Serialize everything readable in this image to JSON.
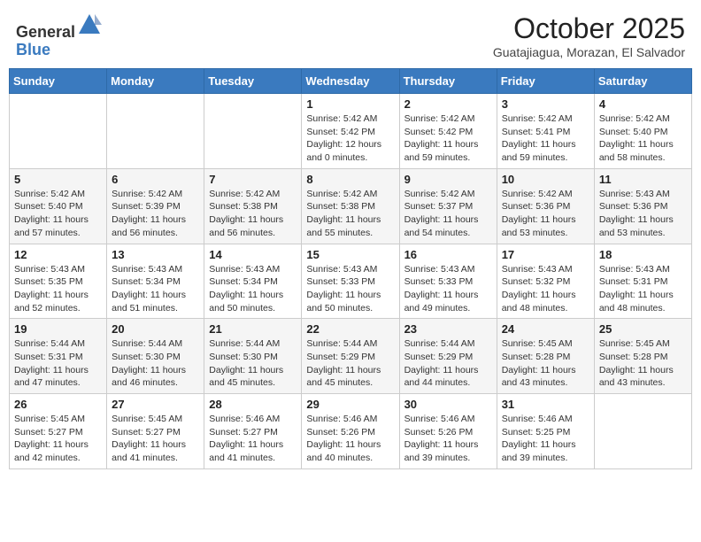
{
  "logo": {
    "general": "General",
    "blue": "Blue"
  },
  "header": {
    "month": "October 2025",
    "location": "Guatajiagua, Morazan, El Salvador"
  },
  "days_of_week": [
    "Sunday",
    "Monday",
    "Tuesday",
    "Wednesday",
    "Thursday",
    "Friday",
    "Saturday"
  ],
  "weeks": [
    [
      {
        "day": "",
        "info": ""
      },
      {
        "day": "",
        "info": ""
      },
      {
        "day": "",
        "info": ""
      },
      {
        "day": "1",
        "info": "Sunrise: 5:42 AM\nSunset: 5:42 PM\nDaylight: 12 hours\nand 0 minutes."
      },
      {
        "day": "2",
        "info": "Sunrise: 5:42 AM\nSunset: 5:42 PM\nDaylight: 11 hours\nand 59 minutes."
      },
      {
        "day": "3",
        "info": "Sunrise: 5:42 AM\nSunset: 5:41 PM\nDaylight: 11 hours\nand 59 minutes."
      },
      {
        "day": "4",
        "info": "Sunrise: 5:42 AM\nSunset: 5:40 PM\nDaylight: 11 hours\nand 58 minutes."
      }
    ],
    [
      {
        "day": "5",
        "info": "Sunrise: 5:42 AM\nSunset: 5:40 PM\nDaylight: 11 hours\nand 57 minutes."
      },
      {
        "day": "6",
        "info": "Sunrise: 5:42 AM\nSunset: 5:39 PM\nDaylight: 11 hours\nand 56 minutes."
      },
      {
        "day": "7",
        "info": "Sunrise: 5:42 AM\nSunset: 5:38 PM\nDaylight: 11 hours\nand 56 minutes."
      },
      {
        "day": "8",
        "info": "Sunrise: 5:42 AM\nSunset: 5:38 PM\nDaylight: 11 hours\nand 55 minutes."
      },
      {
        "day": "9",
        "info": "Sunrise: 5:42 AM\nSunset: 5:37 PM\nDaylight: 11 hours\nand 54 minutes."
      },
      {
        "day": "10",
        "info": "Sunrise: 5:42 AM\nSunset: 5:36 PM\nDaylight: 11 hours\nand 53 minutes."
      },
      {
        "day": "11",
        "info": "Sunrise: 5:43 AM\nSunset: 5:36 PM\nDaylight: 11 hours\nand 53 minutes."
      }
    ],
    [
      {
        "day": "12",
        "info": "Sunrise: 5:43 AM\nSunset: 5:35 PM\nDaylight: 11 hours\nand 52 minutes."
      },
      {
        "day": "13",
        "info": "Sunrise: 5:43 AM\nSunset: 5:34 PM\nDaylight: 11 hours\nand 51 minutes."
      },
      {
        "day": "14",
        "info": "Sunrise: 5:43 AM\nSunset: 5:34 PM\nDaylight: 11 hours\nand 50 minutes."
      },
      {
        "day": "15",
        "info": "Sunrise: 5:43 AM\nSunset: 5:33 PM\nDaylight: 11 hours\nand 50 minutes."
      },
      {
        "day": "16",
        "info": "Sunrise: 5:43 AM\nSunset: 5:33 PM\nDaylight: 11 hours\nand 49 minutes."
      },
      {
        "day": "17",
        "info": "Sunrise: 5:43 AM\nSunset: 5:32 PM\nDaylight: 11 hours\nand 48 minutes."
      },
      {
        "day": "18",
        "info": "Sunrise: 5:43 AM\nSunset: 5:31 PM\nDaylight: 11 hours\nand 48 minutes."
      }
    ],
    [
      {
        "day": "19",
        "info": "Sunrise: 5:44 AM\nSunset: 5:31 PM\nDaylight: 11 hours\nand 47 minutes."
      },
      {
        "day": "20",
        "info": "Sunrise: 5:44 AM\nSunset: 5:30 PM\nDaylight: 11 hours\nand 46 minutes."
      },
      {
        "day": "21",
        "info": "Sunrise: 5:44 AM\nSunset: 5:30 PM\nDaylight: 11 hours\nand 45 minutes."
      },
      {
        "day": "22",
        "info": "Sunrise: 5:44 AM\nSunset: 5:29 PM\nDaylight: 11 hours\nand 45 minutes."
      },
      {
        "day": "23",
        "info": "Sunrise: 5:44 AM\nSunset: 5:29 PM\nDaylight: 11 hours\nand 44 minutes."
      },
      {
        "day": "24",
        "info": "Sunrise: 5:45 AM\nSunset: 5:28 PM\nDaylight: 11 hours\nand 43 minutes."
      },
      {
        "day": "25",
        "info": "Sunrise: 5:45 AM\nSunset: 5:28 PM\nDaylight: 11 hours\nand 43 minutes."
      }
    ],
    [
      {
        "day": "26",
        "info": "Sunrise: 5:45 AM\nSunset: 5:27 PM\nDaylight: 11 hours\nand 42 minutes."
      },
      {
        "day": "27",
        "info": "Sunrise: 5:45 AM\nSunset: 5:27 PM\nDaylight: 11 hours\nand 41 minutes."
      },
      {
        "day": "28",
        "info": "Sunrise: 5:46 AM\nSunset: 5:27 PM\nDaylight: 11 hours\nand 41 minutes."
      },
      {
        "day": "29",
        "info": "Sunrise: 5:46 AM\nSunset: 5:26 PM\nDaylight: 11 hours\nand 40 minutes."
      },
      {
        "day": "30",
        "info": "Sunrise: 5:46 AM\nSunset: 5:26 PM\nDaylight: 11 hours\nand 39 minutes."
      },
      {
        "day": "31",
        "info": "Sunrise: 5:46 AM\nSunset: 5:25 PM\nDaylight: 11 hours\nand 39 minutes."
      },
      {
        "day": "",
        "info": ""
      }
    ]
  ]
}
